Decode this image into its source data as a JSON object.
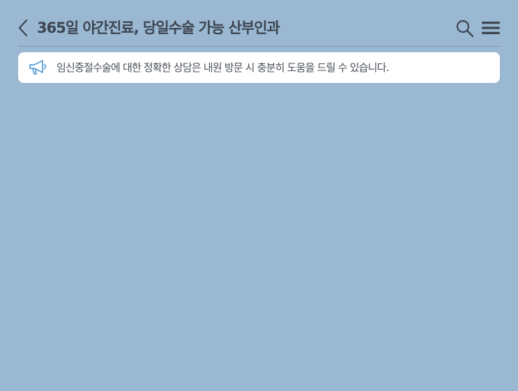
{
  "header": {
    "title": "365일 야간진료, 당일수술 가능 산부인과",
    "back_icon": "chevron-left-icon",
    "search_icon": "search-icon",
    "menu_icon": "hamburger-menu-icon"
  },
  "notice": {
    "icon": "megaphone-icon",
    "text": "임신중절수술에 대한 정확한 상담은 내원 방문 시 충분히 도움을 드릴 수 있습니다."
  },
  "colors": {
    "background": "#9ab8d1",
    "title_text": "#3d4551",
    "icon_dark": "#3d4551",
    "notice_bg": "#ffffff",
    "notice_icon": "#5a9fd4",
    "notice_text": "#4a4f57",
    "divider": "#7f9ab2"
  }
}
